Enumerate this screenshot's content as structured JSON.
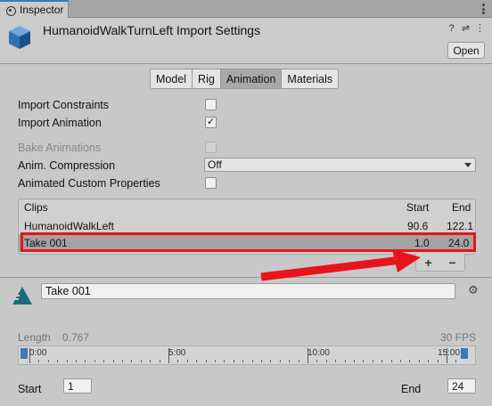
{
  "tab": {
    "label": "Inspector",
    "icon": "info-icon"
  },
  "header": {
    "title": "HumanoidWalkTurnLeft Import Settings",
    "open_label": "Open",
    "icons": [
      "help-icon",
      "preset-icon",
      "more-icon"
    ]
  },
  "tabs": [
    {
      "label": "Model",
      "active": false
    },
    {
      "label": "Rig",
      "active": false
    },
    {
      "label": "Animation",
      "active": true
    },
    {
      "label": "Materials",
      "active": false
    }
  ],
  "props": {
    "import_constraints": {
      "label": "Import Constraints",
      "checked": false
    },
    "import_animation": {
      "label": "Import Animation",
      "checked": true,
      "mark": "✓"
    },
    "bake_animations": {
      "label": "Bake Animations",
      "checked": false,
      "disabled": true
    },
    "anim_compression": {
      "label": "Anim. Compression",
      "value": "Off"
    },
    "animated_custom_properties": {
      "label": "Animated Custom Properties",
      "checked": false
    }
  },
  "clips": {
    "header": {
      "name": "Clips",
      "start": "Start",
      "end": "End"
    },
    "rows": [
      {
        "name": "HumanoidWalkLeft",
        "start": "90.6",
        "end": "122.1",
        "selected": false
      },
      {
        "name": "Take 001",
        "start": "1.0",
        "end": "24.0",
        "selected": true
      }
    ],
    "add_label": "+",
    "remove_label": "−"
  },
  "clip_detail": {
    "name": "Take 001",
    "length_label": "Length",
    "length_value": "0.767",
    "fps": "30 FPS",
    "timeline_labels": [
      "0:00",
      "5:00",
      "10:00",
      "15:00"
    ],
    "start_label": "Start",
    "start_value": "1",
    "end_label": "End",
    "end_value": "24"
  },
  "colors": {
    "accent": "#3a79bb",
    "highlight": "#e8141b"
  }
}
